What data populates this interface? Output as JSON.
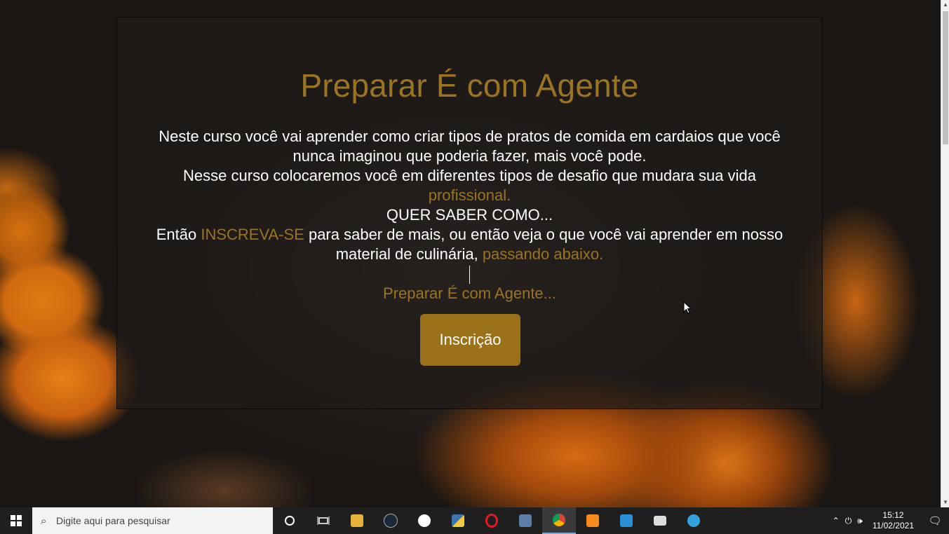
{
  "page": {
    "title": "Preparar É com Agente",
    "line1": "Neste curso você vai aprender como criar tipos de pratos de comida em cardaios que você nunca imaginou que poderia fazer, mais você pode.",
    "line2_pre": "Nesse curso colocaremos você em diferentes tipos de desafio que mudara sua vida ",
    "line2_gold": "profissional.",
    "line3": "QUER SABER COMO...",
    "line4_pre": "Então ",
    "line4_gold": "INSCREVA-SE",
    "line4_mid": " para saber de mais, ou então veja o que você vai aprender em nosso material de culinária, ",
    "line4_gold2": "passando abaixo.",
    "tagline": "Preparar É com Agente...",
    "button_label": "Inscrição"
  },
  "colors": {
    "accent_gold": "#9a7422",
    "button_gold": "#9a7118"
  },
  "taskbar": {
    "search_placeholder": "Digite aqui para pesquisar",
    "apps": [
      "cortana-icon",
      "task-view-icon",
      "file-explorer-icon",
      "steam-icon",
      "whatsapp-icon",
      "python-icon",
      "opera-icon",
      "calculator-icon",
      "chrome-icon",
      "sublime-text-icon",
      "vscode-icon",
      "remote-desktop-icon",
      "telegram-icon"
    ],
    "time": "15:12",
    "date": "11/02/2021"
  }
}
